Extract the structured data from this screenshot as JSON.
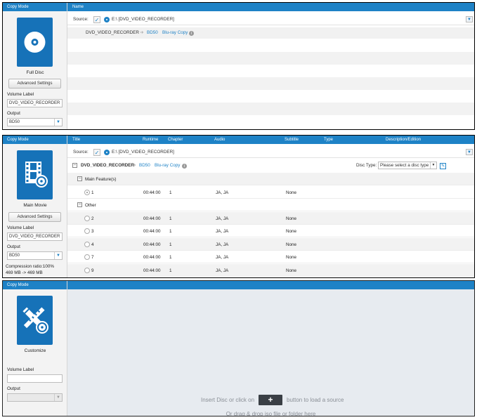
{
  "colors": {
    "accent": "#1e82c6",
    "header": "#1e82c6",
    "tile": "#1672b8",
    "empty_bg": "#e7ebf0"
  },
  "panel1": {
    "left_header": "Copy Mode",
    "right_header": "Name",
    "mode_label": "Full Disc",
    "mode_icon": "disc-icon",
    "advanced_button": "Advanced Settings",
    "volume_label_caption": "Volume Label",
    "volume_label_value": "DVD_VIDEO_RECORDER",
    "output_caption": "Output",
    "output_value": "BD50",
    "source_label": "Source:",
    "source_path": "E:\\ [DVD_VIDEO_RECORDER]",
    "path_name": "DVD_VIDEO_RECORDER",
    "path_target": "BD50",
    "path_copy": "Blu-ray Copy"
  },
  "panel2": {
    "left_header": "Copy Mode",
    "columns": [
      "Title",
      "Runtime",
      "Chapter",
      "Audio",
      "Subtitle",
      "Type",
      "Description/Edition"
    ],
    "mode_label": "Main Movie",
    "mode_icon": "film-disc-icon",
    "advanced_button": "Advanced Settings",
    "volume_label_caption": "Volume Label",
    "volume_label_value": "DVD_VIDEO_RECORDER",
    "output_caption": "Output",
    "output_value": "BD50",
    "compression_text": "Compression ratio:100%",
    "size_text": "469 MB -> 469 MB",
    "source_label": "Source:",
    "source_path": "E:\\ [DVD_VIDEO_RECORDER]",
    "path_name": "DVD_VIDEO_RECORDER",
    "path_target": "BD50",
    "path_copy": "Blu-ray Copy",
    "disc_type_label": "Disc Type:",
    "disc_type_value": "Please select a disc type",
    "group_main": "Main Feature(s)",
    "group_other": "Other",
    "main_rows": [
      {
        "title": "1",
        "runtime": "00:44:00",
        "chapter": "1",
        "audio": "JA, JA",
        "subtitle": "None",
        "selected": true
      }
    ],
    "other_rows": [
      {
        "title": "2",
        "runtime": "00:44:00",
        "chapter": "1",
        "audio": "JA, JA",
        "subtitle": "None",
        "selected": false
      },
      {
        "title": "3",
        "runtime": "00:44:00",
        "chapter": "1",
        "audio": "JA, JA",
        "subtitle": "None",
        "selected": false
      },
      {
        "title": "4",
        "runtime": "00:44:00",
        "chapter": "1",
        "audio": "JA, JA",
        "subtitle": "None",
        "selected": false
      },
      {
        "title": "7",
        "runtime": "00:44:00",
        "chapter": "1",
        "audio": "JA, JA",
        "subtitle": "None",
        "selected": false
      },
      {
        "title": "9",
        "runtime": "00:44:00",
        "chapter": "1",
        "audio": "JA, JA",
        "subtitle": "None",
        "selected": false
      }
    ]
  },
  "panel3": {
    "left_header": "Copy Mode",
    "mode_label": "Customize",
    "mode_icon": "pencil-disc-icon",
    "volume_label_caption": "Volume Label",
    "volume_label_value": "",
    "output_caption": "Output",
    "output_value": "",
    "insert_prefix": "Insert Disc or click on",
    "insert_suffix": "button to load a source",
    "drag_text": "Or drag & drop iso file or folder here",
    "plus_label": "+"
  }
}
